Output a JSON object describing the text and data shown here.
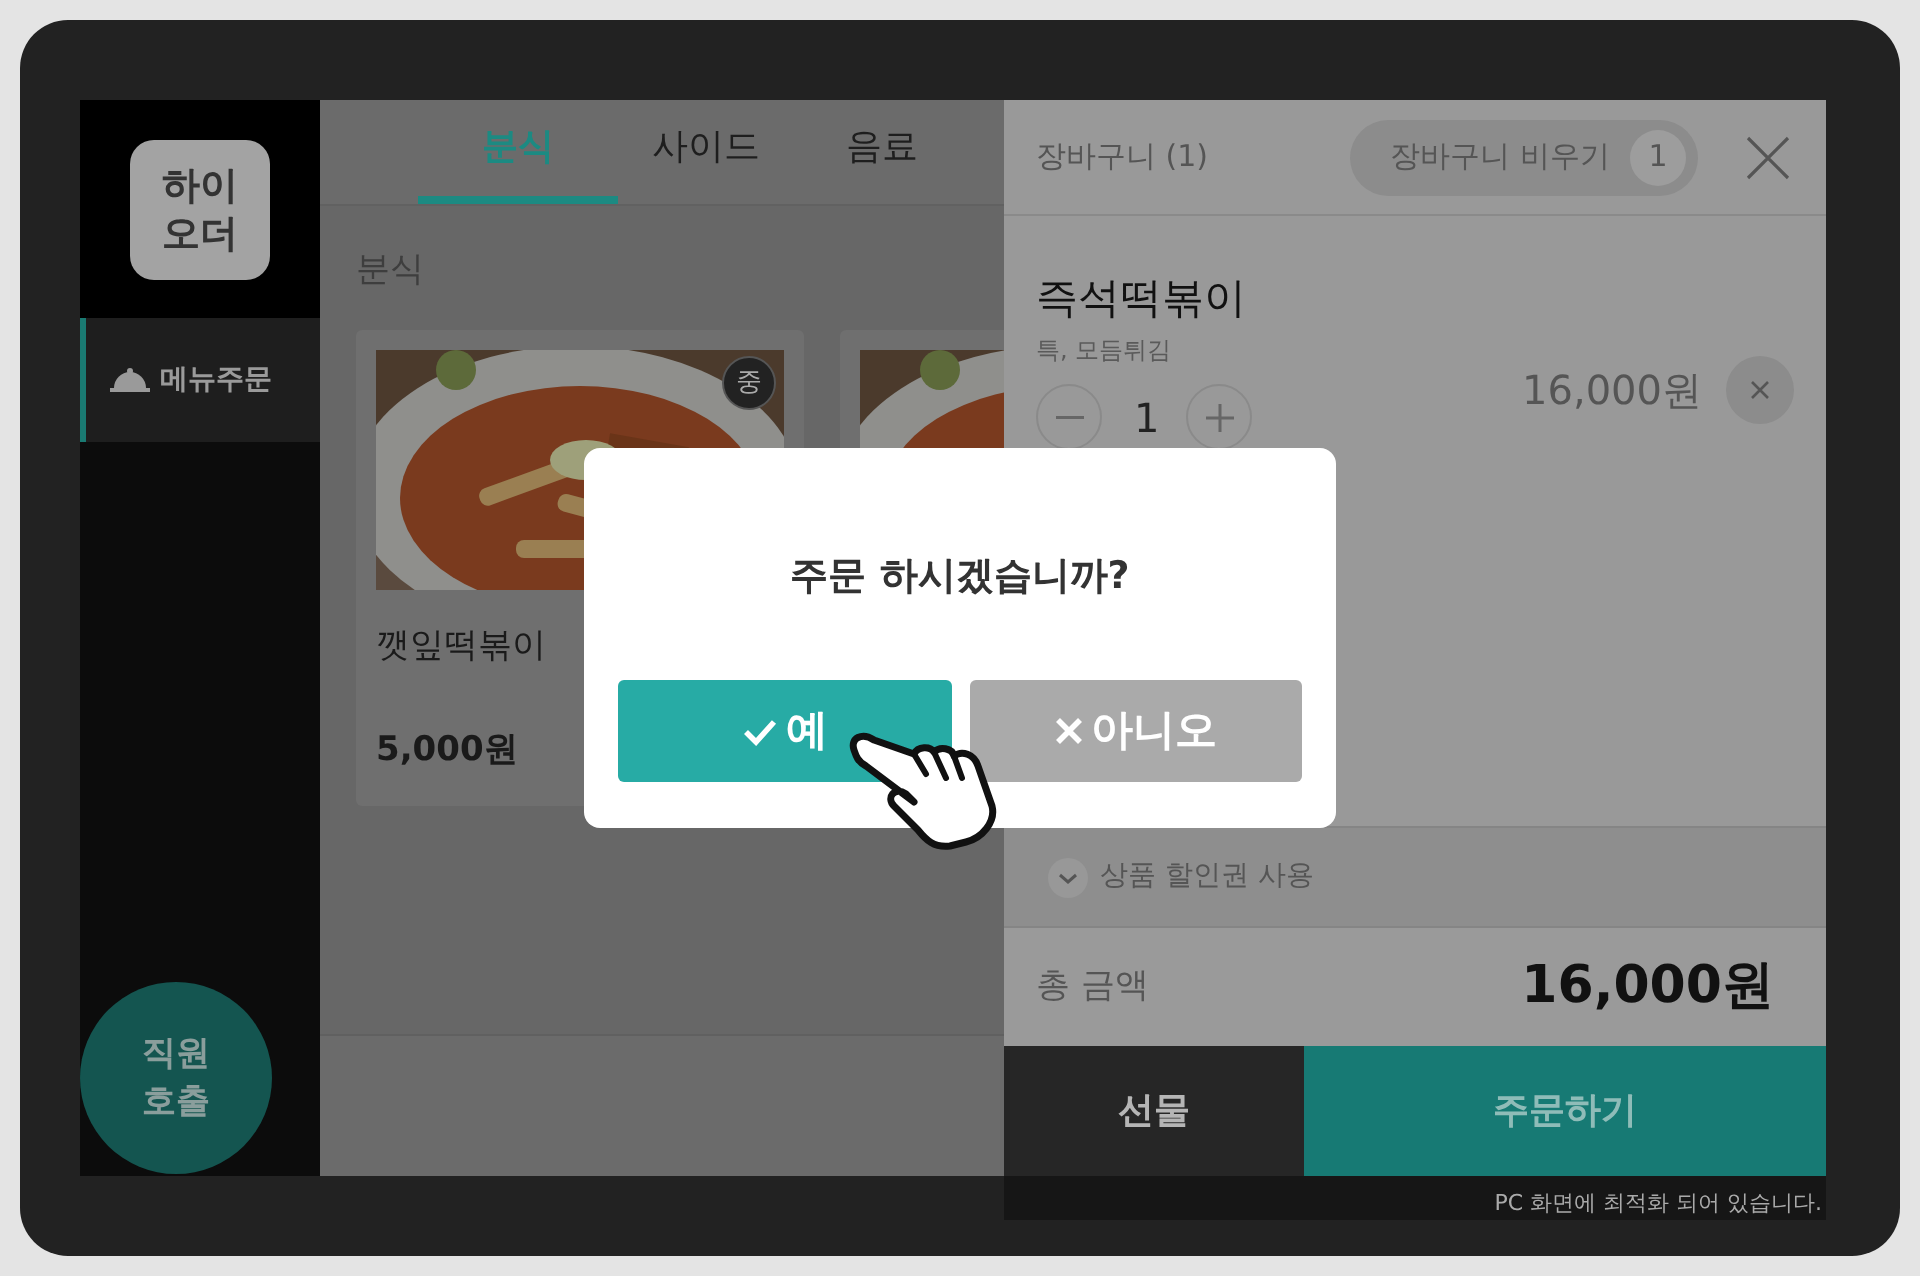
{
  "sidebar": {
    "logo": "하이\n오더",
    "items": [
      {
        "label": "메뉴주문",
        "selected": true
      }
    ],
    "call_button": "직원\n호출"
  },
  "tabs": [
    {
      "label": "분식",
      "selected": true
    },
    {
      "label": "사이드",
      "selected": false
    },
    {
      "label": "음료",
      "selected": false
    }
  ],
  "section_title": "분식",
  "menu_items": [
    {
      "kind": "product",
      "name": "깻잎떡볶이",
      "price": "5,000원",
      "badge": "중"
    },
    {
      "kind": "picture"
    }
  ],
  "cart": {
    "title": "장바구니 (1)",
    "clear_button": "장바구니 비우기",
    "clear_count": "1",
    "items": [
      {
        "name": "즉석떡볶이",
        "options": "특, 모듬튀김",
        "quantity": "1",
        "price": "16,000원"
      }
    ],
    "discount": "상품 할인권 사용",
    "total_label": "총 금액",
    "total": "16,000원",
    "gift_button": "선물",
    "order_button": "주문하기",
    "notice": "PC 화면에 최적화 되어 있습니다."
  },
  "dialog": {
    "message": "주문 하시겠습니까?",
    "yes": "예",
    "no": "아니오"
  }
}
